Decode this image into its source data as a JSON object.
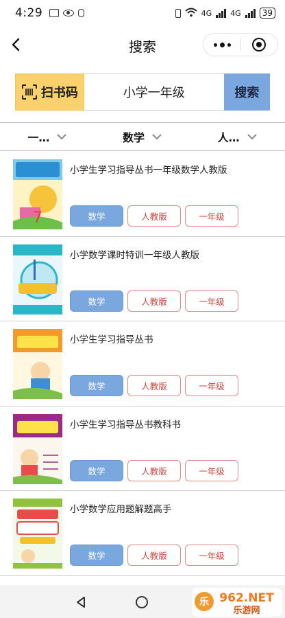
{
  "status_bar": {
    "time": "4:29",
    "network_1": "4G",
    "network_2": "4G",
    "battery": "39"
  },
  "nav": {
    "title": "搜索",
    "back_icon": "chevron-left-icon",
    "more_icon": "more-dots-icon",
    "close_icon": "target-close-icon"
  },
  "search": {
    "scan_label": "扫书码",
    "scan_icon": "scan-barcode-icon",
    "query": "小学一年级",
    "button_label": "搜索"
  },
  "filters": [
    {
      "label": "一…"
    },
    {
      "label": "数学"
    },
    {
      "label": "人…"
    }
  ],
  "books": [
    {
      "title": "小学生学习指导丛书一年级数学人教版",
      "tags": [
        "数学",
        "人教版",
        "一年级"
      ],
      "cover_color": "#e86aa4"
    },
    {
      "title": "小学数学课时特训一年级人教版",
      "tags": [
        "数学",
        "人教版",
        "一年级"
      ],
      "cover_color": "#2cb7c9"
    },
    {
      "title": "小学生学习指导丛书",
      "tags": [
        "数学",
        "人教版",
        "一年级"
      ],
      "cover_color": "#f29a2e"
    },
    {
      "title": "小学生学习指导丛书教科书",
      "tags": [
        "数学",
        "人教版",
        "一年级"
      ],
      "cover_color": "#9b2b86"
    },
    {
      "title": "小学数学应用题解题高手",
      "tags": [
        "数学",
        "人教版",
        "一年级"
      ],
      "cover_color": "#8fc33d"
    }
  ],
  "colors": {
    "scan_bg": "#fbd16d",
    "search_btn_bg": "#7aa7dd",
    "tag_subject_bg": "#7aa7dd",
    "tag_outline": "#e08a8a"
  },
  "watermark": {
    "brand": "962.NET",
    "subtitle": "乐游网"
  }
}
